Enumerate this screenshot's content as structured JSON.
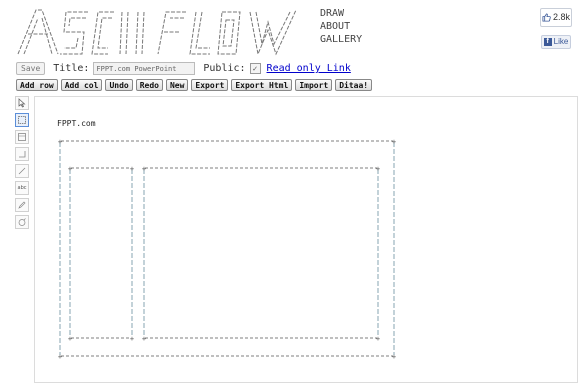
{
  "nav": {
    "items": [
      "DRAW",
      "ABOUT",
      "GALLERY"
    ]
  },
  "social": {
    "like_count": "2.8k",
    "like_label": "Like"
  },
  "toolbar": {
    "save_label": "Save",
    "title_label": "Title:",
    "title_value": "FPPT.com PowerPoint",
    "public_label": "Public:",
    "public_checked": true,
    "readonly_link": "Read only Link",
    "buttons": [
      "Add row",
      "Add col",
      "Undo",
      "Redo",
      "New",
      "Export",
      "Export Html",
      "Import",
      "Ditaa!"
    ]
  },
  "tools": [
    {
      "name": "pointer-icon",
      "active": false
    },
    {
      "name": "rectangle-icon",
      "active": true
    },
    {
      "name": "box-icon",
      "active": false
    },
    {
      "name": "corner-line-icon",
      "active": false
    },
    {
      "name": "line-icon",
      "active": false
    },
    {
      "name": "text-icon",
      "label": "abc",
      "active": false
    },
    {
      "name": "pencil-icon",
      "active": false
    },
    {
      "name": "eraser-icon",
      "active": false
    }
  ],
  "canvas": {
    "title": "FPPT.com"
  },
  "colors": {
    "link": "#0000cc",
    "active_tool": "#5b8ed8",
    "facebook": "#3b5998"
  }
}
